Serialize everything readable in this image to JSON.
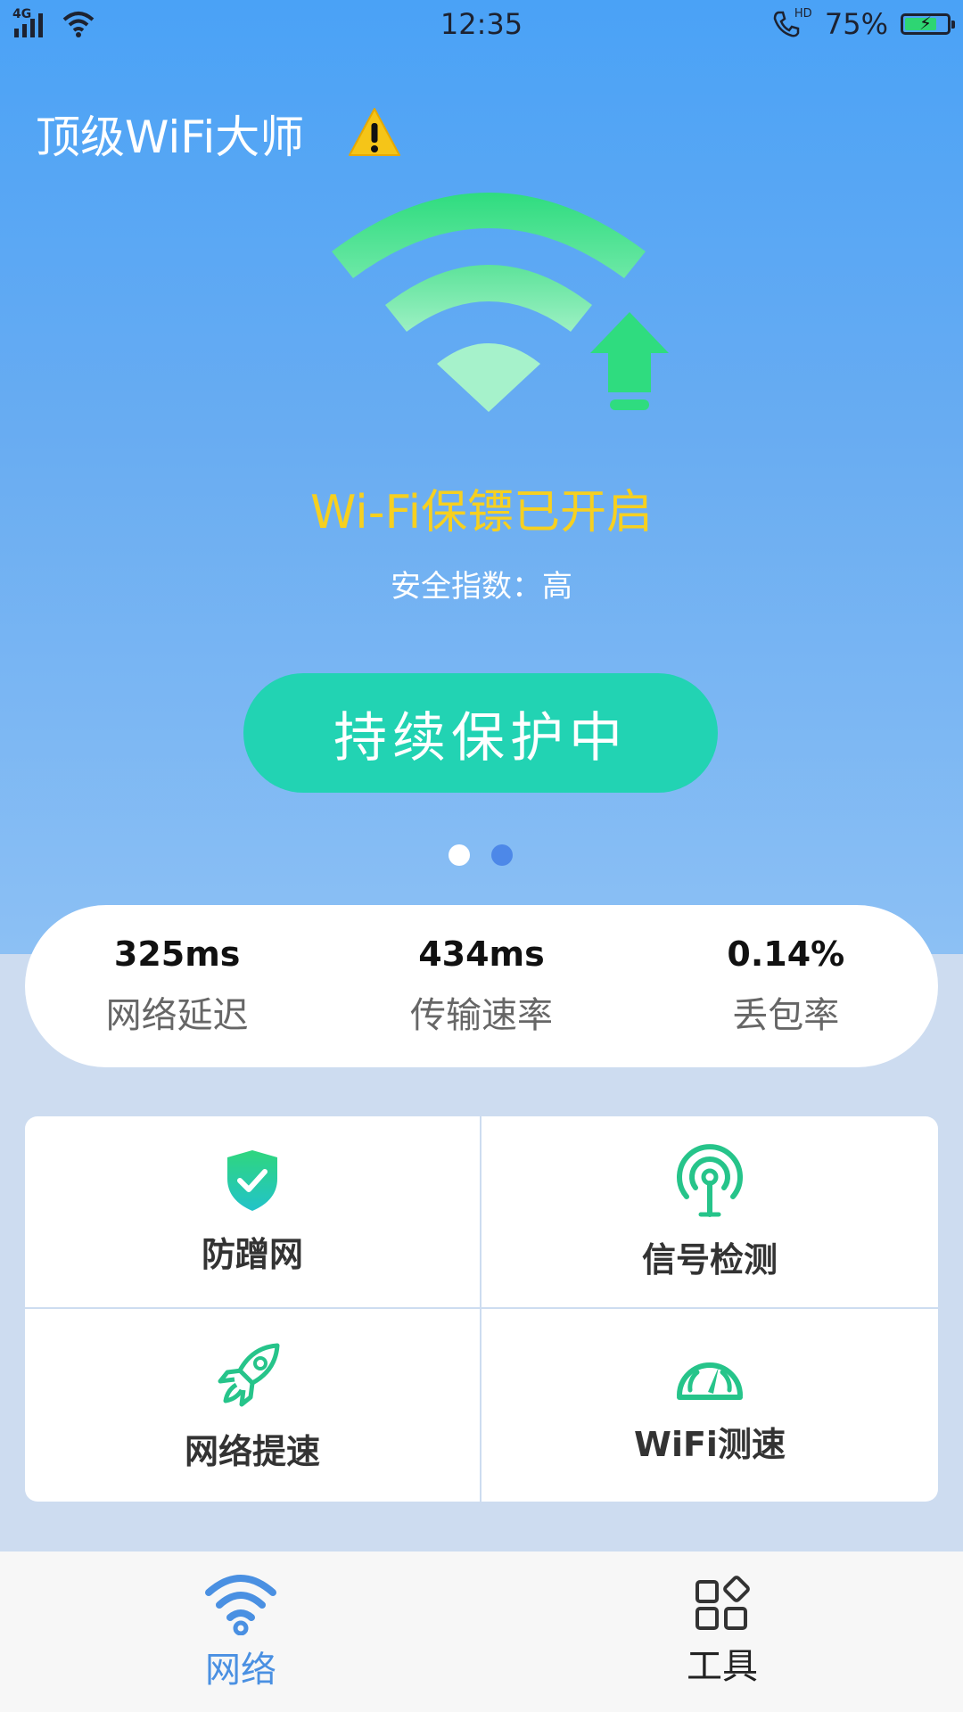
{
  "status_bar": {
    "network": "4G",
    "time": "12:35",
    "call_badge": "HD",
    "battery_percent": "75%",
    "battery_level": 0.75
  },
  "header": {
    "app_title": "顶级WiFi大师",
    "warning_icon": "warning-triangle-icon"
  },
  "hero": {
    "status_title": "Wi-Fi保镖已开启",
    "safety_text": "安全指数：高",
    "protect_button_label": "持续保护中",
    "pager": {
      "total": 2,
      "active_index": 0
    }
  },
  "stats": [
    {
      "value": "325ms",
      "label": "网络延迟"
    },
    {
      "value": "434ms",
      "label": "传输速率"
    },
    {
      "value": "0.14%",
      "label": "丢包率"
    }
  ],
  "tools": [
    {
      "label": "防蹭网",
      "icon": "shield-check-icon"
    },
    {
      "label": "信号检测",
      "icon": "signal-antenna-icon"
    },
    {
      "label": "网络提速",
      "icon": "rocket-icon"
    },
    {
      "label": "WiFi测速",
      "icon": "speedometer-icon"
    }
  ],
  "tabbar": [
    {
      "label": "网络",
      "icon": "wifi-icon",
      "active": true
    },
    {
      "label": "工具",
      "icon": "grid-apps-icon",
      "active": false
    }
  ],
  "colors": {
    "accent_green": "#22d3b3",
    "title_yellow": "#f6d020",
    "tab_active_blue": "#4a90e2",
    "hero_blue": "#4aa2f6"
  }
}
